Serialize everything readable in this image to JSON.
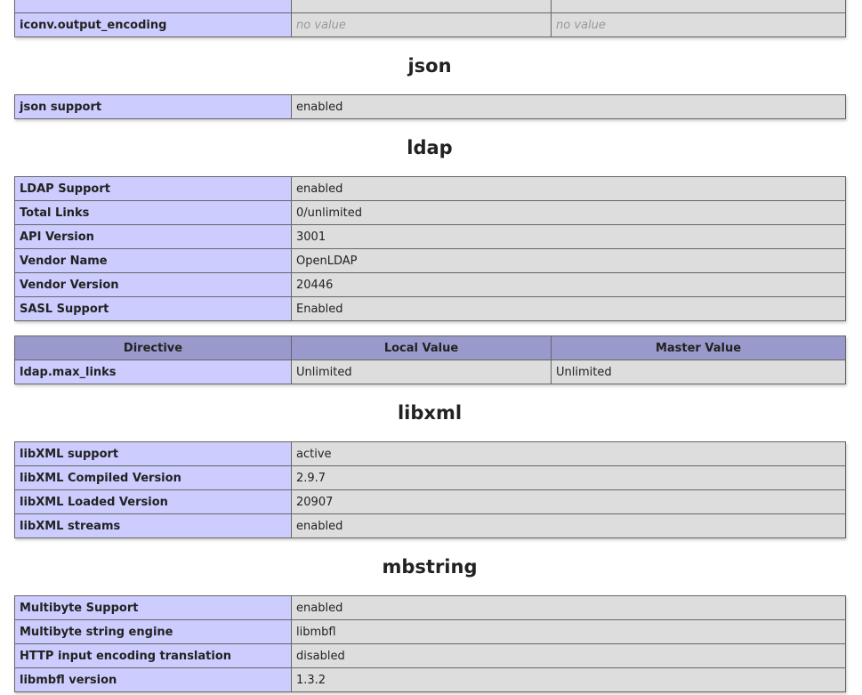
{
  "iconv": {
    "rows": [
      {
        "directive": "",
        "local": "",
        "master": ""
      },
      {
        "directive": "iconv.output_encoding",
        "local": "no value",
        "master": "no value"
      }
    ]
  },
  "json": {
    "title": "json",
    "rows": [
      {
        "label": "json support",
        "value": "enabled"
      }
    ]
  },
  "ldap": {
    "title": "ldap",
    "rows": [
      {
        "label": "LDAP Support",
        "value": "enabled"
      },
      {
        "label": "Total Links",
        "value": "0/unlimited"
      },
      {
        "label": "API Version",
        "value": "3001"
      },
      {
        "label": "Vendor Name",
        "value": "OpenLDAP"
      },
      {
        "label": "Vendor Version",
        "value": "20446"
      },
      {
        "label": "SASL Support",
        "value": "Enabled"
      }
    ],
    "directives": {
      "headers": [
        "Directive",
        "Local Value",
        "Master Value"
      ],
      "rows": [
        {
          "directive": "ldap.max_links",
          "local": "Unlimited",
          "master": "Unlimited"
        }
      ]
    }
  },
  "libxml": {
    "title": "libxml",
    "rows": [
      {
        "label": "libXML support",
        "value": "active"
      },
      {
        "label": "libXML Compiled Version",
        "value": "2.9.7"
      },
      {
        "label": "libXML Loaded Version",
        "value": "20907"
      },
      {
        "label": "libXML streams",
        "value": "enabled"
      }
    ]
  },
  "mbstring": {
    "title": "mbstring",
    "rows": [
      {
        "label": "Multibyte Support",
        "value": "enabled"
      },
      {
        "label": "Multibyte string engine",
        "value": "libmbfl"
      },
      {
        "label": "HTTP input encoding translation",
        "value": "disabled"
      },
      {
        "label": "libmbfl version",
        "value": "1.3.2"
      }
    ]
  }
}
